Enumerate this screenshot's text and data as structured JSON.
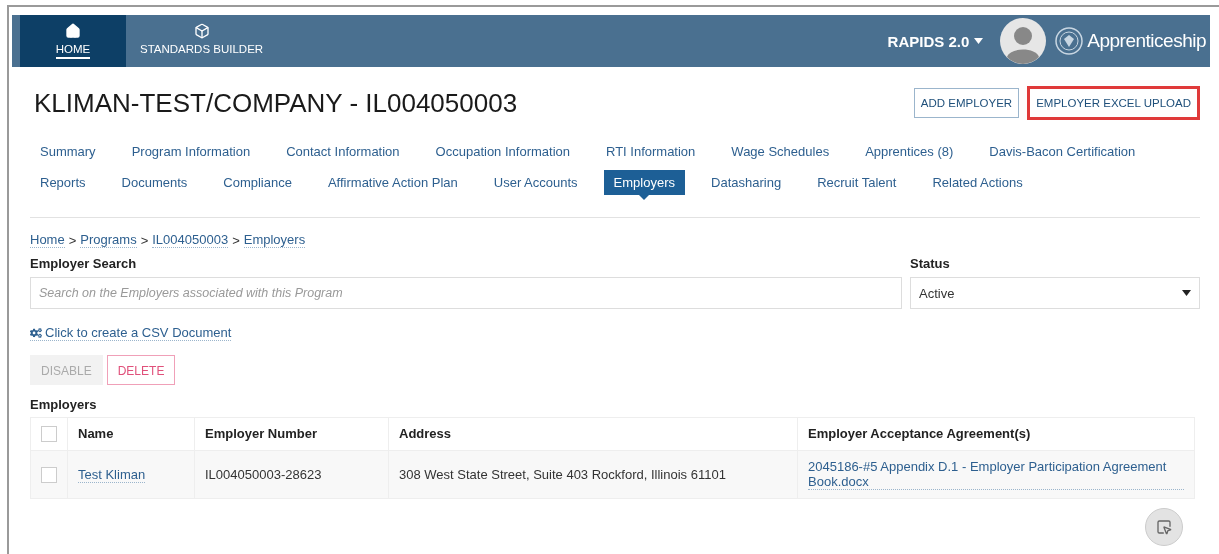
{
  "nav": {
    "items": [
      {
        "label": "HOME",
        "kind": "home",
        "selected": true
      },
      {
        "label": "STANDARDS BUILDER",
        "kind": "cube",
        "selected": false
      }
    ],
    "product_menu": "RAPIDS 2.0",
    "brand": "Apprenticeship"
  },
  "page": {
    "title": "KLIMAN-TEST/COMPANY - IL004050003",
    "actions": [
      {
        "label": "ADD EMPLOYER",
        "highlighted": false
      },
      {
        "label": "EMPLOYER EXCEL UPLOAD",
        "highlighted": true
      }
    ]
  },
  "tab_rows": [
    {
      "tabs": [
        {
          "label": "Summary",
          "selected": false
        },
        {
          "label": "Program Information",
          "selected": false
        },
        {
          "label": "Contact Information",
          "selected": false
        },
        {
          "label": "Occupation Information",
          "selected": false
        },
        {
          "label": "RTI Information",
          "selected": false
        },
        {
          "label": "Wage Schedules",
          "selected": false
        },
        {
          "label": "Apprentices (8)",
          "selected": false
        },
        {
          "label": "Davis-Bacon Certification",
          "selected": false
        }
      ]
    },
    {
      "tabs": [
        {
          "label": "Reports",
          "selected": false
        },
        {
          "label": "Documents",
          "selected": false
        },
        {
          "label": "Compliance",
          "selected": false
        },
        {
          "label": "Affirmative Action Plan",
          "selected": false
        },
        {
          "label": "User Accounts",
          "selected": false
        },
        {
          "label": "Employers",
          "selected": true
        },
        {
          "label": "Datasharing",
          "selected": false
        },
        {
          "label": "Recruit Talent",
          "selected": false
        },
        {
          "label": "Related Actions",
          "selected": false
        }
      ]
    }
  ],
  "breadcrumb": {
    "separator": ">",
    "items": [
      "Home",
      "Programs",
      "IL004050003",
      "Employers"
    ]
  },
  "search": {
    "label": "Employer Search",
    "placeholder": "Search on the Employers associated with this Program"
  },
  "status": {
    "label": "Status",
    "value": "Active"
  },
  "csv_link": "Click to create a CSV Document",
  "bulk_actions": [
    {
      "label": "DISABLE",
      "kind": "plain",
      "disabled": true
    },
    {
      "label": "DELETE",
      "kind": "danger",
      "disabled": false
    }
  ],
  "table": {
    "title": "Employers",
    "header_checked": false,
    "columns": [
      "Name",
      "Employer Number",
      "Address",
      "Employer Acceptance Agreement(s)"
    ],
    "rows": [
      {
        "checked": false,
        "name": "Test Kliman",
        "number": "IL004050003-28623",
        "address": "308 West State Street, Suite 403 Rockford, Illinois 61101",
        "agreement": "2045186-#5 Appendix D.1 - Employer Participation Agreement Book.docx"
      }
    ]
  }
}
